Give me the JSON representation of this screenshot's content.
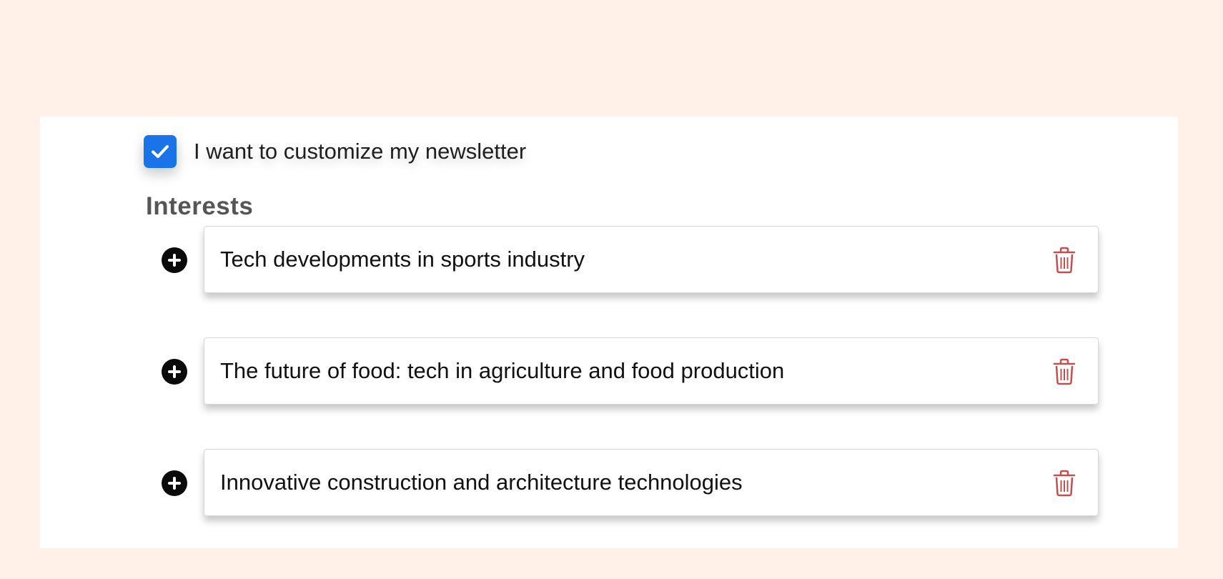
{
  "newsletter": {
    "customize_checked": true,
    "customize_label": "I want to customize my newsletter"
  },
  "interests": {
    "title": "Interests",
    "items": [
      {
        "text": "Tech developments in sports industry"
      },
      {
        "text": "The future of food: tech in agriculture and food production"
      },
      {
        "text": "Innovative construction and architecture technologies"
      }
    ],
    "add_icon": "plus-circle-icon",
    "delete_icon": "trash-icon"
  },
  "colors": {
    "background": "#fff0e8",
    "panel": "#ffffff",
    "checkbox": "#1a73e8",
    "trash": "#c0504d"
  }
}
